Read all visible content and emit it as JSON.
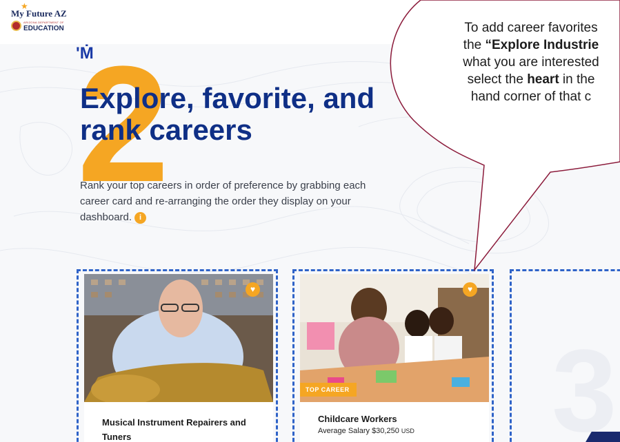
{
  "logo": {
    "top": "My Future AZ",
    "sub": "ARIZONA DEPARTMENT OF",
    "edu": "EDUCATION"
  },
  "brand_mark": "'Ṁ",
  "step_number": "2",
  "heading": "Explore, favorite, and rank careers",
  "description": "Rank your top careers in order of preference by grabbing each career card and re-arranging the order they display on your dashboard.",
  "info_glyph": "i",
  "cards": [
    {
      "title": "Musical Instrument Repairers and Tuners",
      "salary": "",
      "badge": ""
    },
    {
      "title": "Childcare Workers",
      "salary": "Average Salary $30,250",
      "salary_unit": "USD",
      "badge": "TOP CAREER"
    }
  ],
  "slot3_number": "3",
  "callout": {
    "line1": "To add career favorites",
    "line2_pre": "the ",
    "line2_bold": "“Explore Industrie",
    "line3": "what you are interested",
    "line4_pre": "select the ",
    "line4_bold": "heart",
    "line4_post": " in the",
    "line5": "hand corner of that c"
  },
  "colors": {
    "accent": "#f5a623",
    "navy": "#0f2f86",
    "dash": "#2f63c8",
    "bubble_border": "#8b1a3a"
  },
  "icons": {
    "heart": "heart-icon",
    "info": "info-icon"
  }
}
